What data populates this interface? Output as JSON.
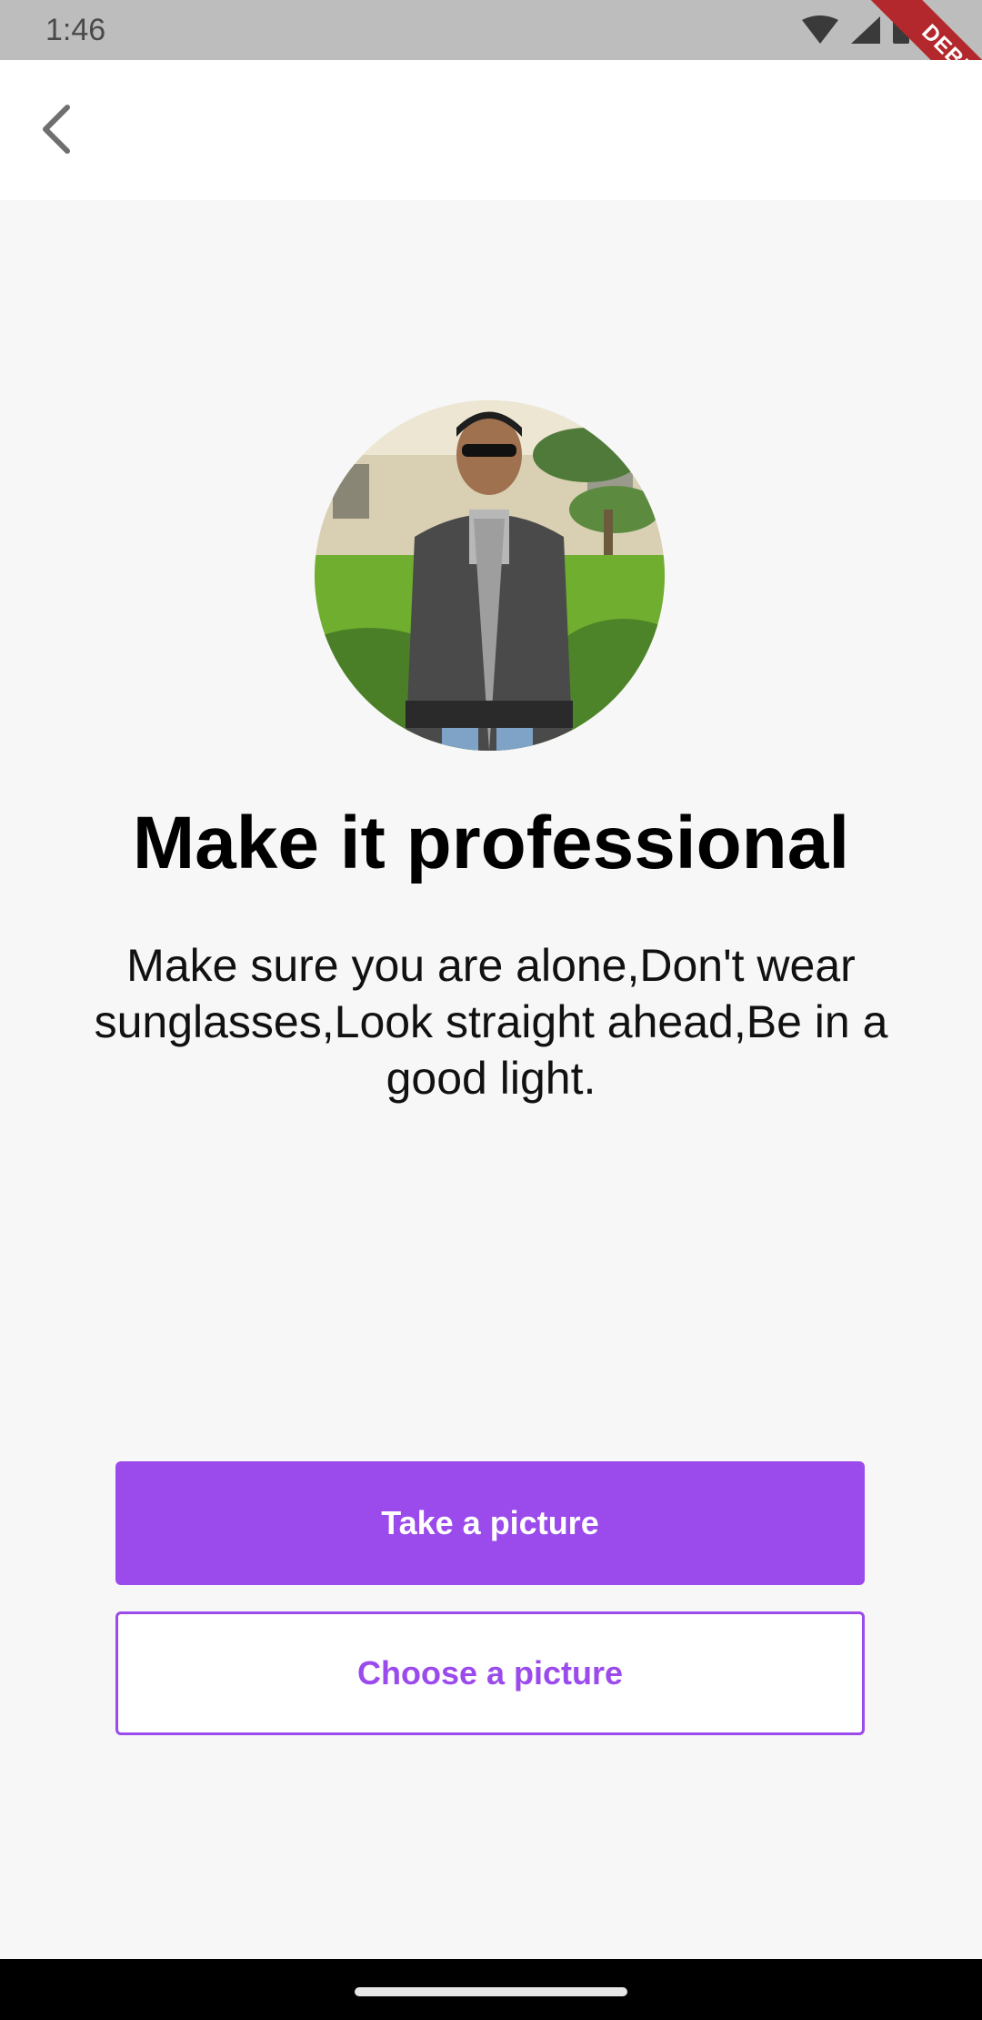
{
  "status_bar": {
    "time": "1:46",
    "icons": [
      "wifi-icon",
      "signal-icon",
      "battery-icon"
    ],
    "debug_label": "DEBUG"
  },
  "app_bar": {
    "back_icon": "chevron-left-icon"
  },
  "content": {
    "title": "Make it professional",
    "subtitle": "Make sure you are alone,Don't wear sunglasses,Look straight ahead,Be in a good light."
  },
  "actions": {
    "take_picture_label": "Take a picture",
    "choose_picture_label": "Choose a picture"
  },
  "colors": {
    "accent": "#9b4aeb",
    "background": "#f7f7f7",
    "status_bar": "#bdbdbd"
  }
}
